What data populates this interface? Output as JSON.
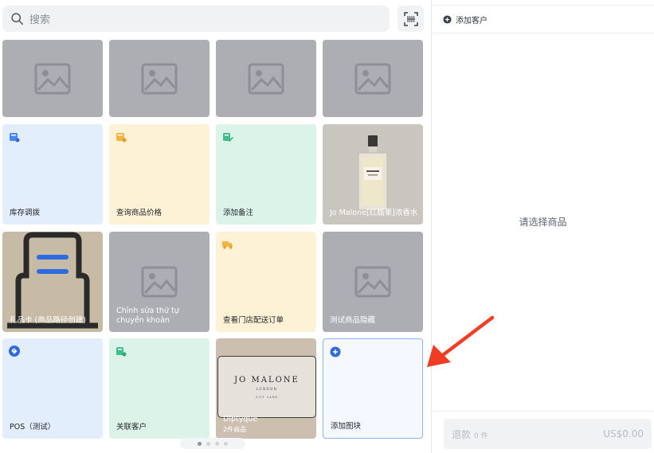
{
  "search": {
    "placeholder": "搜索"
  },
  "tiles": {
    "stock_transfer": "库存调拨",
    "check_price": "查询商品价格",
    "add_note": "添加备注",
    "jo_malone": "Jo Malone[红醋栗]浓香水",
    "gift_card": "礼品卡 (商品路径创建)",
    "chinh_sua": "Chỉnh sửa thứ tự chuyển khoản",
    "store_delivery": "查看门店配送订单",
    "test_hidden": "测试商品隐藏",
    "pos_test": "POS（测试）",
    "link_customer": "关联客户",
    "diptyque": "Diptyque",
    "diptyque_count": "2件商品",
    "add_tile": "添加图块",
    "giftcard_brand": "JO MALONE",
    "giftcard_city": "LONDON",
    "giftcard_text": "GIFT CARD"
  },
  "pagination": {
    "pages": 4,
    "current": 1
  },
  "cart": {
    "add_customer": "添加客户",
    "empty_text": "请选择商品",
    "refund_label": "退款",
    "refund_count": "0 件",
    "refund_amount": "US$0.00"
  },
  "colors": {
    "accent": "#3370ff",
    "arrow": "#f03c22",
    "tile_blue": "#e3eefc",
    "tile_yellow": "#fdf2d6",
    "tile_green": "#dcf3ea",
    "tile_gray": "#acaeb3"
  },
  "icons": [
    "search-icon",
    "scan-icon",
    "image-placeholder-icon",
    "plus-circle-icon",
    "arrow-pointer"
  ]
}
